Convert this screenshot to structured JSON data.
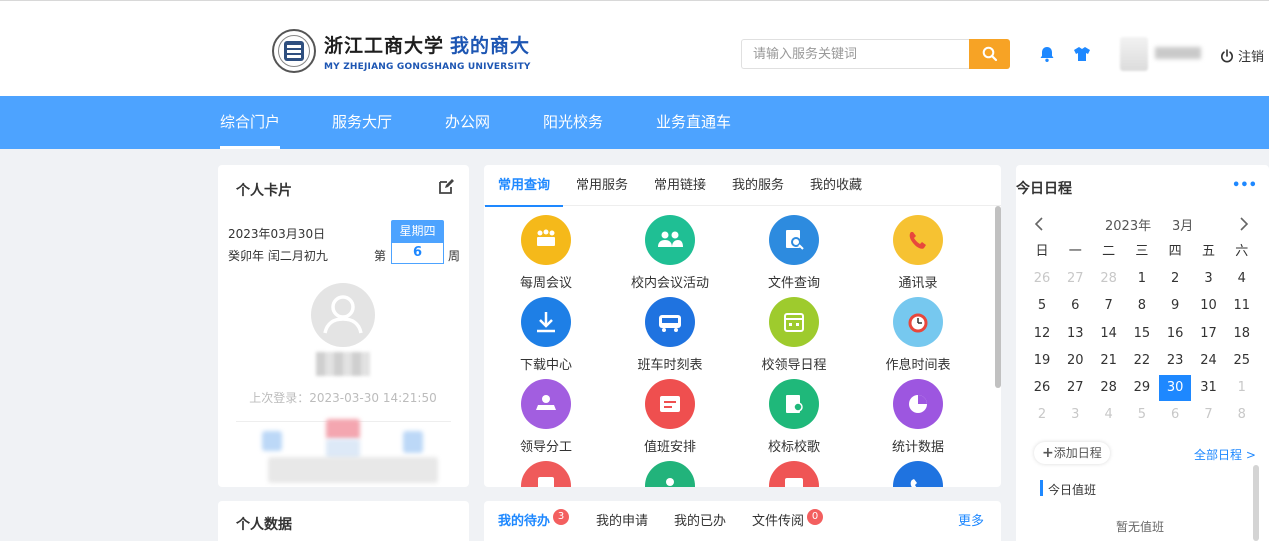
{
  "header": {
    "logo_cn": "浙江工商大学",
    "logo_cn_blue": "我的商大",
    "logo_en": "MY ZHEJIANG GONGSHANG UNIVERSITY",
    "search_placeholder": "请输入服务关键词",
    "logout_label": "注销",
    "icons": [
      "bell-icon",
      "shirt-icon",
      "power-icon",
      "search-icon"
    ]
  },
  "nav": [
    "综合门户",
    "服务大厅",
    "办公网",
    "阳光校务",
    "业务直通车"
  ],
  "personal_card": {
    "title": "个人卡片",
    "date": "2023年03月30日",
    "lunar": "癸卯年 闰二月初九",
    "weekday": "星期四",
    "week_prefix": "第",
    "week_number": "6",
    "week_suffix": "周",
    "last_login": "上次登录：2023-03-30 14:21:50"
  },
  "personal_data": {
    "title": "个人数据"
  },
  "services": {
    "tabs": [
      "常用查询",
      "常用服务",
      "常用链接",
      "我的服务",
      "我的收藏"
    ],
    "items": [
      {
        "label": "每周会议",
        "color": "#f5b91a"
      },
      {
        "label": "校内会议活动",
        "color": "#1fbf94"
      },
      {
        "label": "文件查询",
        "color": "#2d8bdf"
      },
      {
        "label": "通讯录",
        "color": "#f6c232"
      },
      {
        "label": "下载中心",
        "color": "#1e7fe6"
      },
      {
        "label": "班车时刻表",
        "color": "#1f73e0"
      },
      {
        "label": "校领导日程",
        "color": "#9ecb2d"
      },
      {
        "label": "作息时间表",
        "color": "#76c8ef"
      },
      {
        "label": "领导分工",
        "color": "#a25ee0"
      },
      {
        "label": "值班安排",
        "color": "#ef4f4f"
      },
      {
        "label": "校标校歌",
        "color": "#1fb87a"
      },
      {
        "label": "统计数据",
        "color": "#9d56e0"
      },
      {
        "label": "",
        "color": "#ef5a5a"
      },
      {
        "label": "",
        "color": "#22b37b"
      },
      {
        "label": "",
        "color": "#ef5555"
      },
      {
        "label": "",
        "color": "#1f73e0"
      }
    ]
  },
  "todo": {
    "tabs": [
      {
        "label": "我的待办",
        "badge": "3"
      },
      {
        "label": "我的申请",
        "badge": ""
      },
      {
        "label": "我的已办",
        "badge": ""
      },
      {
        "label": "文件传阅",
        "badge": "0"
      }
    ],
    "more": "更多"
  },
  "calendar": {
    "title": "今日日程",
    "more": "•••",
    "year": "2023年",
    "month": "3月",
    "weekdays": [
      "日",
      "一",
      "二",
      "三",
      "四",
      "五",
      "六"
    ],
    "days": [
      [
        "26",
        "27",
        "28",
        "1",
        "2",
        "3",
        "4"
      ],
      [
        "5",
        "6",
        "7",
        "8",
        "9",
        "10",
        "11"
      ],
      [
        "12",
        "13",
        "14",
        "15",
        "16",
        "17",
        "18"
      ],
      [
        "19",
        "20",
        "21",
        "22",
        "23",
        "24",
        "25"
      ],
      [
        "26",
        "27",
        "28",
        "29",
        "30",
        "31",
        "1"
      ],
      [
        "2",
        "3",
        "4",
        "5",
        "6",
        "7",
        "8"
      ]
    ],
    "today": "30",
    "add_label": "添加日程",
    "all_label": "全部日程 >",
    "duty_title": "今日值班",
    "no_duty": "暂无值班"
  }
}
